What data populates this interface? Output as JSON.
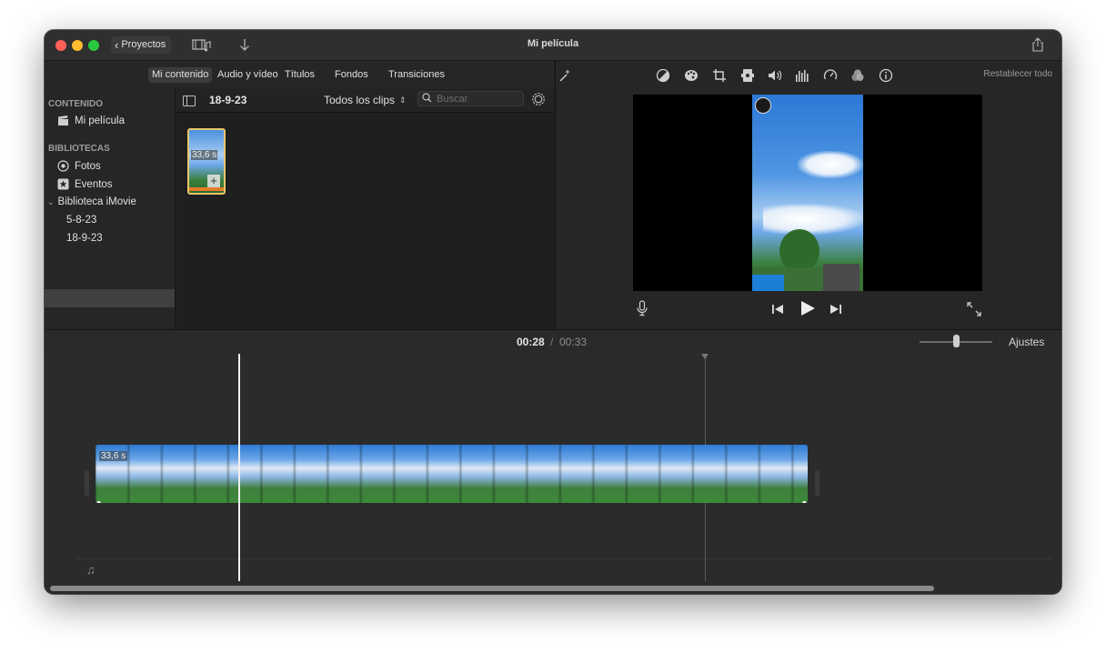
{
  "window": {
    "title": "Mi película"
  },
  "toolbar": {
    "projects_label": "Proyectos"
  },
  "browser": {
    "tabs": [
      {
        "label": "Mi contenido",
        "active": true
      },
      {
        "label": "Audio y vídeo",
        "active": false
      },
      {
        "label": "Títulos",
        "active": false
      },
      {
        "label": "Fondos",
        "active": false
      },
      {
        "label": "Transiciones",
        "active": false
      }
    ],
    "current_event": "18-9-23",
    "filter": "Todos los clips",
    "search_placeholder": "Buscar",
    "clip_duration": "33,6 s"
  },
  "sidebar": {
    "content_header": "CONTENIDO",
    "movie": "Mi película",
    "libraries_header": "BIBLIOTECAS",
    "photos": "Fotos",
    "events": "Eventos",
    "library": "Biblioteca iMovie",
    "event_items": [
      "5-8-23",
      "18-9-23"
    ],
    "selected_event": "18-9-23"
  },
  "viewer": {
    "reset_label": "Restablecer todo",
    "tools": [
      "magic-wand-icon",
      "color-balance-icon",
      "color-palette-icon",
      "crop-icon",
      "stabilization-icon",
      "volume-icon",
      "equalizer-icon",
      "speed-icon",
      "filter-icon",
      "info-icon"
    ]
  },
  "timeline": {
    "current_time": "00:28",
    "separator": "/",
    "total_time": "00:33",
    "settings_label": "Ajustes",
    "clip_duration": "33,6 s",
    "playhead_fraction": 0.2,
    "zoom_level": 0.5
  },
  "colors": {
    "accent": "#2e6fca",
    "close": "#fe5f57",
    "minimize": "#febc2e",
    "zoom": "#28c840"
  }
}
